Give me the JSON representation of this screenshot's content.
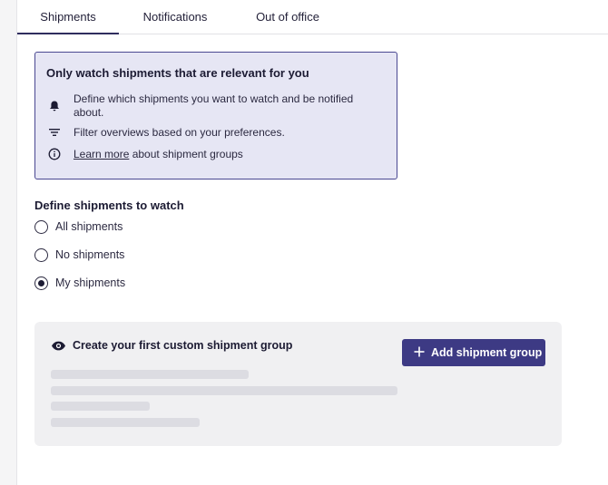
{
  "tabs": [
    {
      "label": "Shipments",
      "active": true
    },
    {
      "label": "Notifications",
      "active": false
    },
    {
      "label": "Out of office",
      "active": false
    }
  ],
  "info_box": {
    "title": "Only watch shipments that are relevant for you",
    "items": [
      {
        "icon": "bell-icon",
        "text": "Define which shipments you want to watch and be notified about."
      },
      {
        "icon": "filter-icon",
        "text": "Filter overviews based on your preferences."
      },
      {
        "icon": "info-icon",
        "link_text": "Learn more",
        "text": " about shipment groups"
      }
    ]
  },
  "watch_section": {
    "title": "Define shipments to watch",
    "options": [
      {
        "label": "All shipments",
        "selected": false
      },
      {
        "label": "No shipments",
        "selected": false
      },
      {
        "label": "My shipments",
        "selected": true
      }
    ]
  },
  "group_card": {
    "icon": "eye-icon",
    "title": "Create your first custom shipment group",
    "button_label": "Add shipment group"
  },
  "colors": {
    "accent": "#3d3a84",
    "info_bg": "#e6e6f4",
    "info_border": "#4a4891",
    "card_bg": "#f0f0f2",
    "skeleton": "#dcdce2"
  }
}
